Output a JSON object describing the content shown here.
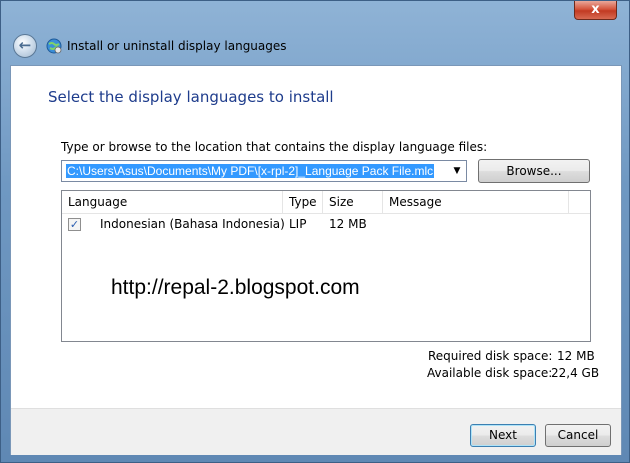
{
  "window": {
    "title": "Install or uninstall display languages",
    "close_label": "x"
  },
  "nav": {
    "back_glyph": "←"
  },
  "page": {
    "heading": "Select the display languages to install",
    "path_label": "Type or browse to the location that contains the display language files:",
    "path_value": "C:\\Users\\Asus\\Documents\\My PDF\\[x-rpl-2]_Language Pack File.mlc",
    "browse_label": "Browse..."
  },
  "table": {
    "columns": [
      "Language",
      "Type",
      "Size",
      "Message"
    ],
    "rows": [
      {
        "checked": true,
        "language": "Indonesian (Bahasa Indonesia)",
        "type": "LIP",
        "size": "12 MB",
        "message": ""
      }
    ]
  },
  "watermark": "http://repal-2.blogspot.com",
  "disk": {
    "required_label": "Required disk space:",
    "required_value": "12 MB",
    "available_label": "Available disk space:",
    "available_value": "22,4 GB"
  },
  "footer": {
    "next_label": "Next",
    "cancel_label": "Cancel"
  },
  "colors": {
    "heading": "#1e3c8c",
    "selection": "#3399ff"
  },
  "icons": {
    "back": "back-arrow-icon",
    "app": "globe-network-icon",
    "dropdown": "chevron-down-icon",
    "check": "checkmark-icon"
  }
}
